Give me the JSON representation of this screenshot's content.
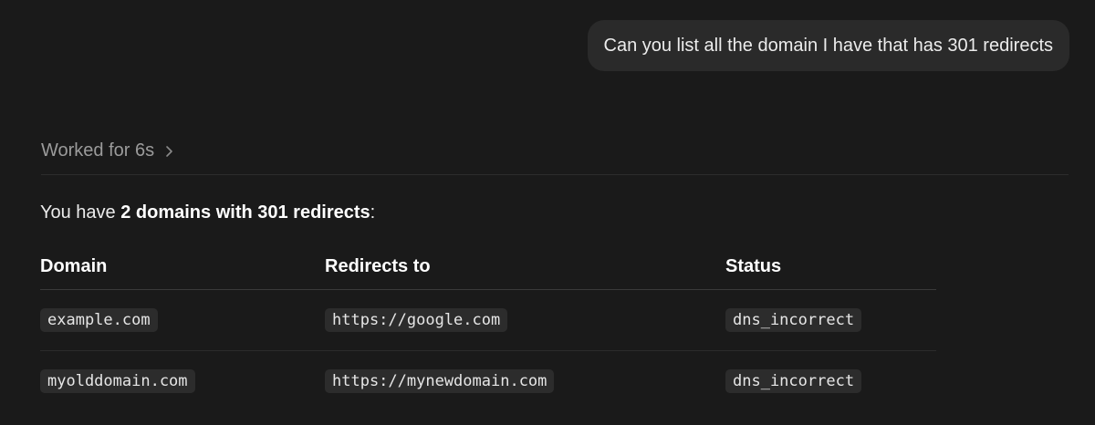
{
  "user_message": {
    "text": "Can you list all the domain I have that has 301 redirects"
  },
  "assistant": {
    "worked_label": "Worked for 6s",
    "chevron_icon": "chevron-right-icon",
    "summary_prefix": "You have ",
    "summary_bold": "2 domains with 301 redirects",
    "summary_suffix": ":"
  },
  "table": {
    "headers": [
      "Domain",
      "Redirects to",
      "Status"
    ],
    "rows": [
      {
        "domain": "example.com",
        "redirect": "https://google.com",
        "status": "dns_incorrect"
      },
      {
        "domain": "myolddomain.com",
        "redirect": "https://mynewdomain.com",
        "status": "dns_incorrect"
      }
    ]
  },
  "colors": {
    "background": "#1a1a1a",
    "bubble": "#2a2a2a",
    "code_bg": "#2c2c2c",
    "muted_text": "#9b9b9b"
  }
}
